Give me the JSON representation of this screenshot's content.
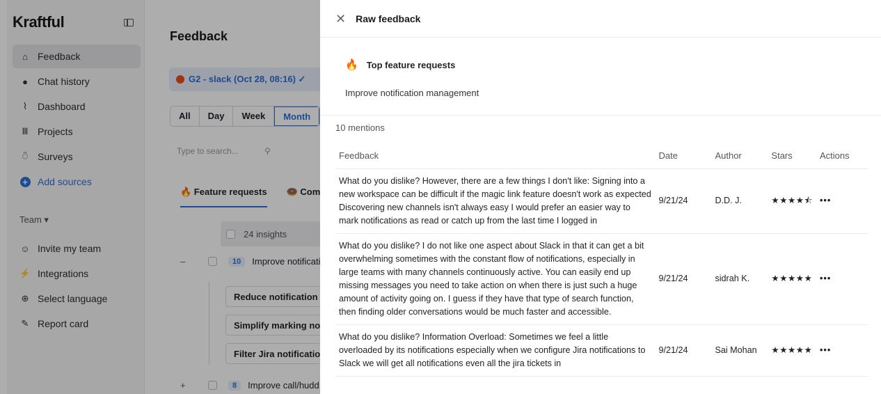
{
  "sidebar": {
    "logo": "Kraftful",
    "nav": [
      {
        "label": "Feedback",
        "icon": "home-icon",
        "glyph": "⌂"
      },
      {
        "label": "Chat history",
        "icon": "chat-icon",
        "glyph": "●"
      },
      {
        "label": "Dashboard",
        "icon": "chart-icon",
        "glyph": "⌇"
      },
      {
        "label": "Projects",
        "icon": "projects-icon",
        "glyph": "Ⅲ"
      },
      {
        "label": "Surveys",
        "icon": "surveys-icon",
        "glyph": "⍥"
      },
      {
        "label": "Add sources",
        "icon": "add-icon",
        "glyph": "+"
      }
    ],
    "team_label": "Team ▾",
    "team_nav": [
      {
        "label": "Invite my team",
        "icon": "invite-icon",
        "glyph": "☺"
      },
      {
        "label": "Integrations",
        "icon": "integrations-icon",
        "glyph": "⚡"
      },
      {
        "label": "Select language",
        "icon": "globe-icon",
        "glyph": "⊕"
      },
      {
        "label": "Report card",
        "icon": "report-icon",
        "glyph": "✎"
      }
    ]
  },
  "main": {
    "title": "Feedback",
    "source": "G2 - slack (Oct 28, 08:16) ✓",
    "periods": [
      "All",
      "Day",
      "Week",
      "Month"
    ],
    "search_placeholder": "Type to search...",
    "tabs": [
      "🔥 Feature requests",
      "🍩 Comp"
    ],
    "insights_label": "24 insights",
    "rows": [
      {
        "count": "10",
        "label": "Improve notificati"
      },
      {
        "count": "8",
        "label": "Improve call/hudd"
      }
    ],
    "subitems": [
      "Reduce notification",
      "Simplify marking no",
      "Filter Jira notificatio"
    ]
  },
  "panel": {
    "title": "Raw feedback",
    "section_title": "Top feature requests",
    "request": "Improve notification management",
    "mentions": "10 mentions",
    "columns": [
      "Feedback",
      "Date",
      "Author",
      "Stars",
      "Actions"
    ],
    "rows": [
      {
        "feedback": "What do you dislike? However, there are a few things I don't like: Signing into a new workspace can be difficult if the magic link feature doesn't work as expected Discovering new channels isn't always easy I would prefer an easier way to mark notifications as read or catch up from the last time I logged in",
        "date": "9/21/24",
        "author": "D.D. J.",
        "stars": "★★★★⯪",
        "actions": "•••"
      },
      {
        "feedback": "What do you dislike? I do not like one aspect about Slack in that it can get a bit overwhelming sometimes with the constant flow of notifications, especially in large teams with many channels continuously active. You can easily end up missing messages you need to take action on when there is just such a huge amount of activity going on. I guess if they have that type of search function, then finding older conversations would be much faster and accessible.",
        "date": "9/21/24",
        "author": "sidrah K.",
        "stars": "★★★★★",
        "actions": "•••"
      },
      {
        "feedback": "What do you dislike? Information Overload: Sometimes we feel a little overloaded by its notifications especially when we configure Jira notifications to Slack we will get all notifications even all the jira tickets in",
        "date": "9/21/24",
        "author": "Sai Mohan",
        "stars": "★★★★★",
        "actions": "•••"
      }
    ]
  }
}
